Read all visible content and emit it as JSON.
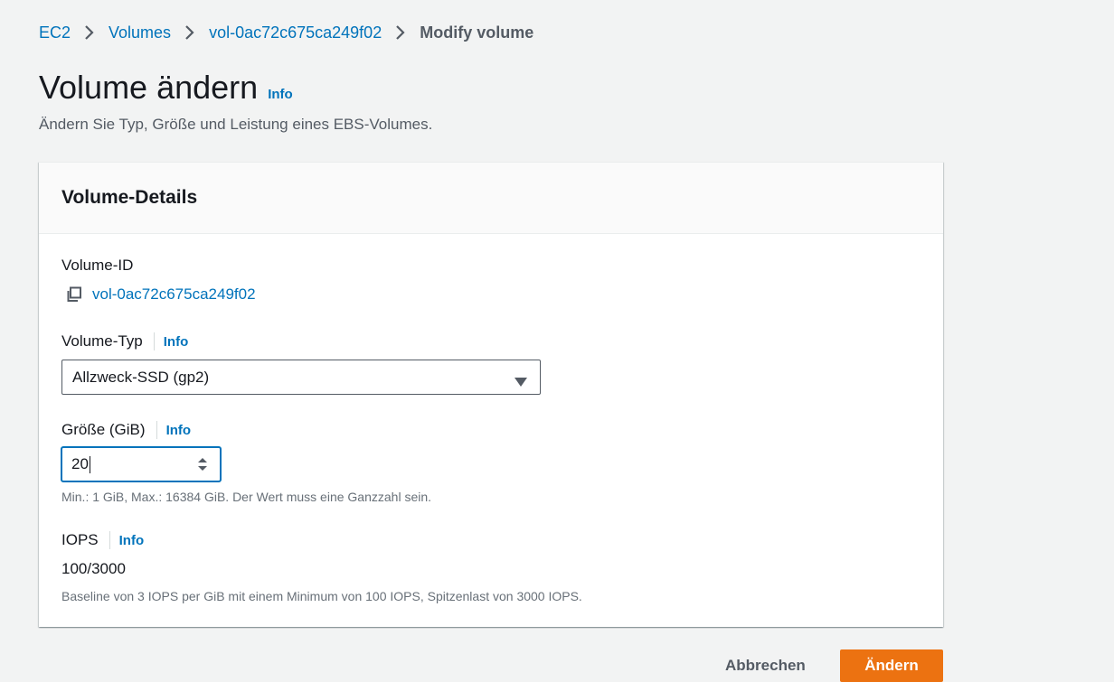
{
  "breadcrumb": {
    "items": [
      "EC2",
      "Volumes",
      "vol-0ac72c675ca249f02"
    ],
    "current": "Modify volume"
  },
  "page": {
    "title": "Volume ändern",
    "info": "Info",
    "description": "Ändern Sie Typ, Größe und Leistung eines EBS-Volumes."
  },
  "card": {
    "title": "Volume-Details",
    "volume_id": {
      "label": "Volume-ID",
      "value": "vol-0ac72c675ca249f02"
    },
    "volume_type": {
      "label": "Volume-Typ",
      "info": "Info",
      "selected": "Allzweck-SSD (gp2)"
    },
    "size": {
      "label": "Größe (GiB)",
      "info": "Info",
      "value": "20",
      "hint": "Min.: 1 GiB, Max.: 16384 GiB. Der Wert muss eine Ganzzahl sein."
    },
    "iops": {
      "label": "IOPS",
      "info": "Info",
      "value": "100/3000",
      "hint": "Baseline von 3 IOPS per GiB mit einem Minimum von 100 IOPS, Spitzenlast von 3000 IOPS."
    }
  },
  "actions": {
    "cancel": "Abbrechen",
    "submit": "Ändern"
  },
  "colors": {
    "link": "#0073bb",
    "primary_button": "#ec7211",
    "focus_border": "#0073bb",
    "background": "#f2f3f3"
  },
  "icons": [
    "chevron-right-icon",
    "copy-icon",
    "caret-down-icon",
    "spinner-icon"
  ]
}
